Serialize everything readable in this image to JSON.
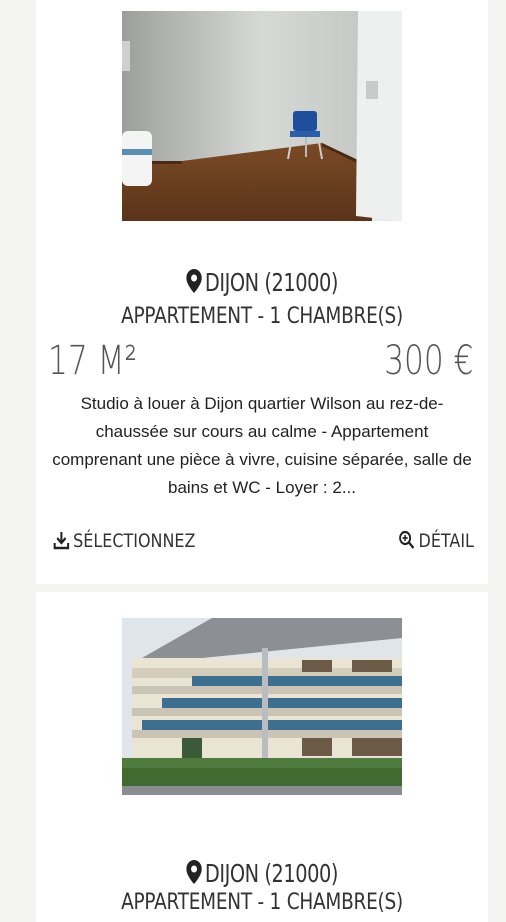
{
  "listings": [
    {
      "city": "DIJON (21000)",
      "type": "APPARTEMENT - 1 CHAMBRE(S)",
      "size": "17 M²",
      "price": "300 €",
      "description": "Studio à louer à Dijon quartier Wilson au rez-de-chaussée sur cours au calme - Appartement comprenant une pièce à vivre, cuisine séparée, salle de bains et WC - Loyer : 2...",
      "select_label": "SÉLECTIONNEZ",
      "detail_label": "DÉTAIL"
    },
    {
      "city": "DIJON (21000)",
      "type": "APPARTEMENT - 1 CHAMBRE(S)"
    }
  ],
  "icons": {
    "location": "map-pin-icon",
    "download": "download-icon",
    "zoom": "zoom-in-icon"
  }
}
